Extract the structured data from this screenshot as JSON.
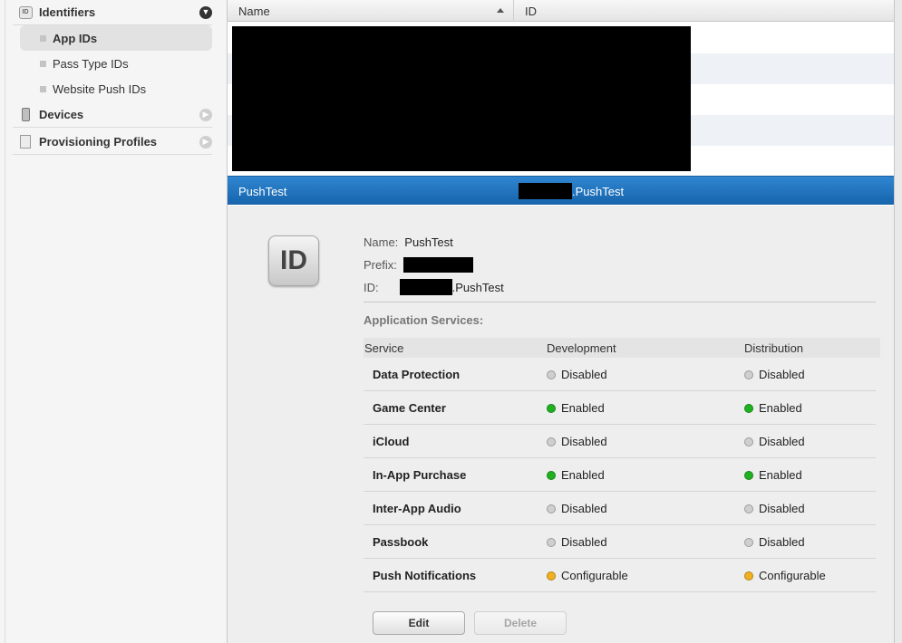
{
  "sidebar": {
    "sections": [
      {
        "label": "Identifiers",
        "icon": "id-badge-icon",
        "icon_text": "ID",
        "expanded": true
      },
      {
        "label": "Devices",
        "icon": "phone-icon",
        "expanded": false
      },
      {
        "label": "Provisioning Profiles",
        "icon": "document-icon",
        "expanded": false
      }
    ],
    "items": [
      {
        "label": "App IDs",
        "selected": true
      },
      {
        "label": "Pass Type IDs",
        "selected": false
      },
      {
        "label": "Website Push IDs",
        "selected": false
      }
    ]
  },
  "list": {
    "columns": {
      "name": "Name",
      "id": "ID"
    },
    "selected_row": {
      "name": "PushTest",
      "id_suffix": ".PushTest"
    }
  },
  "detail": {
    "icon_text": "ID",
    "name_label": "Name:",
    "name_value": "PushTest",
    "prefix_label": "Prefix:",
    "id_label": "ID:",
    "id_suffix": ".PushTest",
    "services_title": "Application Services:",
    "services_headers": {
      "service": "Service",
      "development": "Development",
      "distribution": "Distribution"
    },
    "services": [
      {
        "name": "Data Protection",
        "dev": "Disabled",
        "dist": "Disabled",
        "dev_color": "#cfcfcf",
        "dist_color": "#cfcfcf"
      },
      {
        "name": "Game Center",
        "dev": "Enabled",
        "dist": "Enabled",
        "dev_color": "#1fb11f",
        "dist_color": "#1fb11f"
      },
      {
        "name": "iCloud",
        "dev": "Disabled",
        "dist": "Disabled",
        "dev_color": "#cfcfcf",
        "dist_color": "#cfcfcf"
      },
      {
        "name": "In-App Purchase",
        "dev": "Enabled",
        "dist": "Enabled",
        "dev_color": "#1fb11f",
        "dist_color": "#1fb11f"
      },
      {
        "name": "Inter-App Audio",
        "dev": "Disabled",
        "dist": "Disabled",
        "dev_color": "#cfcfcf",
        "dist_color": "#cfcfcf"
      },
      {
        "name": "Passbook",
        "dev": "Disabled",
        "dist": "Disabled",
        "dev_color": "#cfcfcf",
        "dist_color": "#cfcfcf"
      },
      {
        "name": "Push Notifications",
        "dev": "Configurable",
        "dist": "Configurable",
        "dev_color": "#f0b020",
        "dist_color": "#f0b020"
      }
    ],
    "buttons": {
      "edit": "Edit",
      "delete": "Delete"
    }
  },
  "colors": {
    "selection_blue": "#1f74bf",
    "enabled": "#1fb11f",
    "disabled": "#cfcfcf",
    "configurable": "#f0b020"
  }
}
